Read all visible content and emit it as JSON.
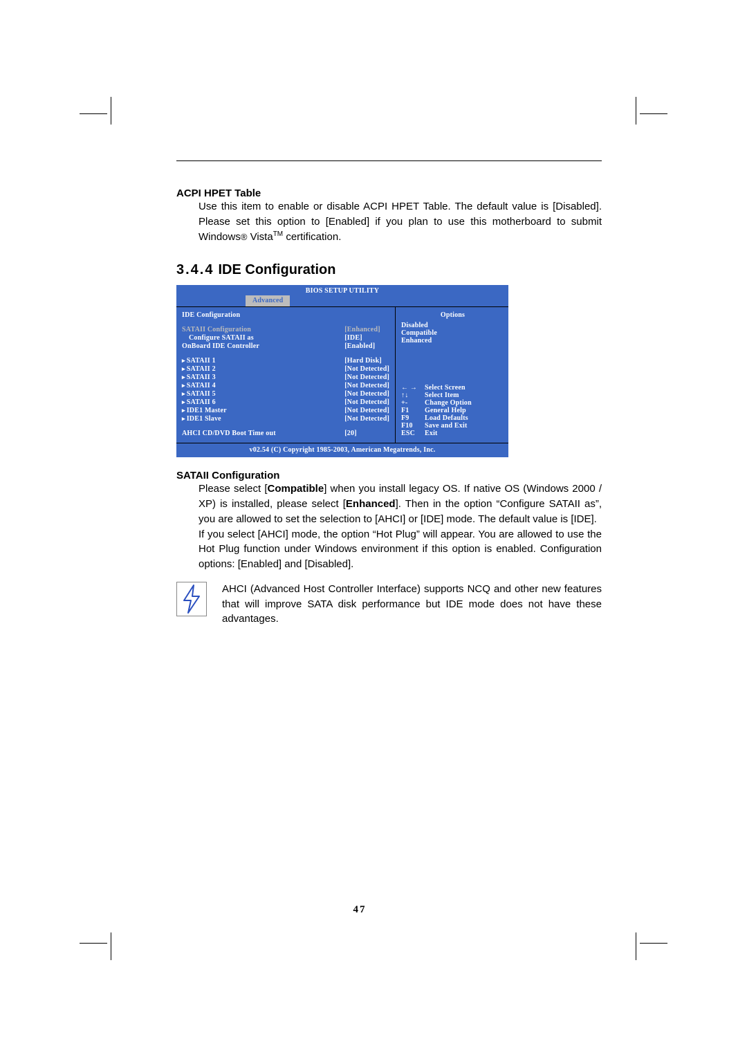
{
  "section1": {
    "heading": "ACPI HPET Table",
    "body": "Use this item to enable or disable ACPI HPET Table. The default value is [Disabled]. Please set this option to [Enabled] if you plan to use this motherboard to submit Windows® Vista™ certification."
  },
  "section2": {
    "num": "3.4.4",
    "title": "IDE Configuration"
  },
  "bios": {
    "title": "BIOS SETUP UTILITY",
    "tab": "Advanced",
    "panel_title": "IDE Configuration",
    "rows_a": [
      {
        "label": "SATAII Configuration",
        "value": "[Enhanced]",
        "selected": true
      },
      {
        "label": "Configure SATAII as",
        "value": "[IDE]",
        "indent": true
      },
      {
        "label": "OnBoard IDE Controller",
        "value": "[Enabled]"
      }
    ],
    "rows_b": [
      {
        "label": "SATAII 1",
        "value": "[Hard Disk]",
        "submenu": true
      },
      {
        "label": "SATAII 2",
        "value": "[Not Detected]",
        "submenu": true
      },
      {
        "label": "SATAII 3",
        "value": "[Not Detected]",
        "submenu": true
      },
      {
        "label": "SATAII 4",
        "value": "[Not Detected]",
        "submenu": true
      },
      {
        "label": "SATAII 5",
        "value": "[Not Detected]",
        "submenu": true
      },
      {
        "label": "SATAII 6",
        "value": "[Not Detected]",
        "submenu": true
      },
      {
        "label": "IDE1 Master",
        "value": "[Not Detected]",
        "submenu": true
      },
      {
        "label": "IDE1 Slave",
        "value": "[Not Detected]",
        "submenu": true
      }
    ],
    "rows_c": [
      {
        "label": "AHCI CD/DVD Boot Time out",
        "value": "[20]"
      }
    ],
    "options_title": "Options",
    "options": [
      "Disabled",
      "Compatible",
      "Enhanced"
    ],
    "hints": [
      {
        "k": "← →",
        "t": "Select Screen"
      },
      {
        "k": "↑↓",
        "t": "Select Item"
      },
      {
        "k": "+-",
        "t": "Change Option"
      },
      {
        "k": "F1",
        "t": "General Help"
      },
      {
        "k": "F9",
        "t": "Load Defaults"
      },
      {
        "k": "F10",
        "t": "Save and Exit"
      },
      {
        "k": "ESC",
        "t": "Exit"
      }
    ],
    "footer": "v02.54 (C) Copyright 1985-2003, American Megatrends, Inc."
  },
  "section3": {
    "heading": "SATAII Configuration",
    "para1_a": "Please select [",
    "para1_b": "Compatible",
    "para1_c": "] when you install legacy OS. If native OS (Windows 2000 / XP) is installed, please select [",
    "para1_d": "Enhanced",
    "para1_e": "]. Then in the option “Configure SATAII as”, you are allowed to set the selection to [AHCI] or [IDE] mode. The default value is [IDE].",
    "para2": "If you select [AHCI] mode, the option “Hot Plug” will appear. You are allowed to use the Hot Plug function under Windows environment if this option is enabled. Configuration options: [Enabled] and [Disabled]."
  },
  "note": "AHCI (Advanced Host Controller Interface) supports NCQ and other new features that will improve SATA disk performance but IDE mode does not have these advantages.",
  "pagenum": "47"
}
